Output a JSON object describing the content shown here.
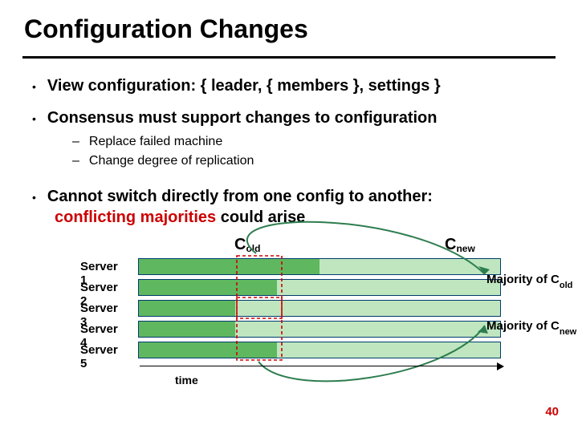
{
  "title": "Configuration Changes",
  "bullet1": "View configuration:  { leader, { members }, settings }",
  "bullet2": "Consensus must support changes to configuration",
  "sub1": "Replace failed machine",
  "sub2": "Change degree of replication",
  "bullet3a": "Cannot switch directly from one config to another:",
  "bullet3b_conf": "conflicting majorities",
  "bullet3b_rest": " could arise",
  "cold_c": "C",
  "cold_s": "old",
  "cnew_c": "C",
  "cnew_s": "new",
  "servers": [
    "Server 1",
    "Server 2",
    "Server 3",
    "Server 4",
    "Server 5"
  ],
  "majority_old_a": "Majority of C",
  "majority_old_s": "old",
  "majority_new_a": "Majority of C",
  "majority_new_s": "new",
  "time_label": "time",
  "page_number": "40",
  "chart_data": {
    "type": "bar",
    "title": "Configuration transition timeline",
    "xlabel": "time",
    "servers": [
      {
        "name": "Server 1",
        "old_extent": 0.5,
        "new_extent": 1.0,
        "in_old_majority": true,
        "in_new_majority": false
      },
      {
        "name": "Server 2",
        "old_extent": 0.38,
        "new_extent": 1.0,
        "in_old_majority": true,
        "in_new_majority": false
      },
      {
        "name": "Server 3",
        "old_extent": 0.27,
        "new_extent": 1.0,
        "in_old_majority": true,
        "in_new_majority": true
      },
      {
        "name": "Server 4",
        "old_extent": 0.27,
        "new_extent": 1.0,
        "in_old_majority": false,
        "in_new_majority": true
      },
      {
        "name": "Server 5",
        "old_extent": 0.38,
        "new_extent": 1.0,
        "in_old_majority": false,
        "in_new_majority": true
      }
    ],
    "colors": {
      "old": "#5fb85f",
      "new": "#bfe6bf",
      "border": "#003b6f",
      "accent": "#cc0000"
    }
  }
}
